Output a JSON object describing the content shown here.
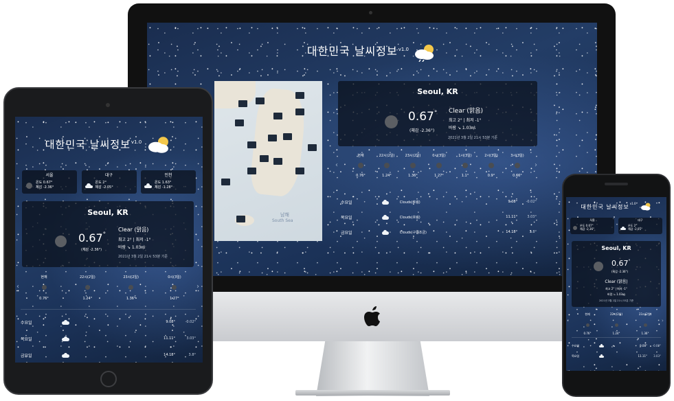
{
  "app": {
    "title": "대한민국 날씨정보",
    "version": "v1.0"
  },
  "current": {
    "city": "Seoul, KR",
    "temp": "0.67",
    "deg": "°",
    "feels": "(체감 -2.36°)",
    "condition": "Clear (맑음)",
    "minmax": "최고 2°  |  최저 -1°",
    "wind": "바람 ↘ 1.03㎧",
    "timestamp": "2021년 3월 2일 21시 53분 기준"
  },
  "hourly": [
    {
      "label": "현재",
      "temp": "0.76°"
    },
    {
      "label": "22시(2일)",
      "temp": "1.24°"
    },
    {
      "label": "23시(2일)",
      "temp": "1.36°"
    },
    {
      "label": "0시(3일)",
      "temp": "1.27°"
    },
    {
      "label": "1시(3일)",
      "temp": "1.1°"
    },
    {
      "label": "2시(3일)",
      "temp": "0.9°"
    },
    {
      "label": "3시(3일)",
      "temp": "0.66°"
    }
  ],
  "daily": [
    {
      "day": "수요일",
      "desc": "Clouds(흐림)",
      "max": "9.08°",
      "min": "-0.02°"
    },
    {
      "day": "목요일",
      "desc": "Clouds(흐림)",
      "max": "11.11°",
      "min": "3.03°"
    },
    {
      "day": "금요일",
      "desc": "Clouds(구름조금)",
      "max": "14.18°",
      "min": "3.8°"
    }
  ],
  "cities": [
    {
      "name": "서울",
      "now": "0.67°",
      "feel": "-2.36°"
    },
    {
      "name": "대구",
      "now": "2°",
      "feel": "-2.05°"
    },
    {
      "name": "인천",
      "now": "1.63°",
      "feel": "-1.28°"
    }
  ],
  "city_labels": {
    "now": "온도",
    "feel": "체감"
  },
  "map": {
    "sea_label": "남해",
    "sea_label_en": "South Sea"
  },
  "colors": {
    "screen_bg": "#1e355c",
    "card_bg": "#0a0f19",
    "moon": "#5b5e63",
    "text": "#ffffff"
  }
}
